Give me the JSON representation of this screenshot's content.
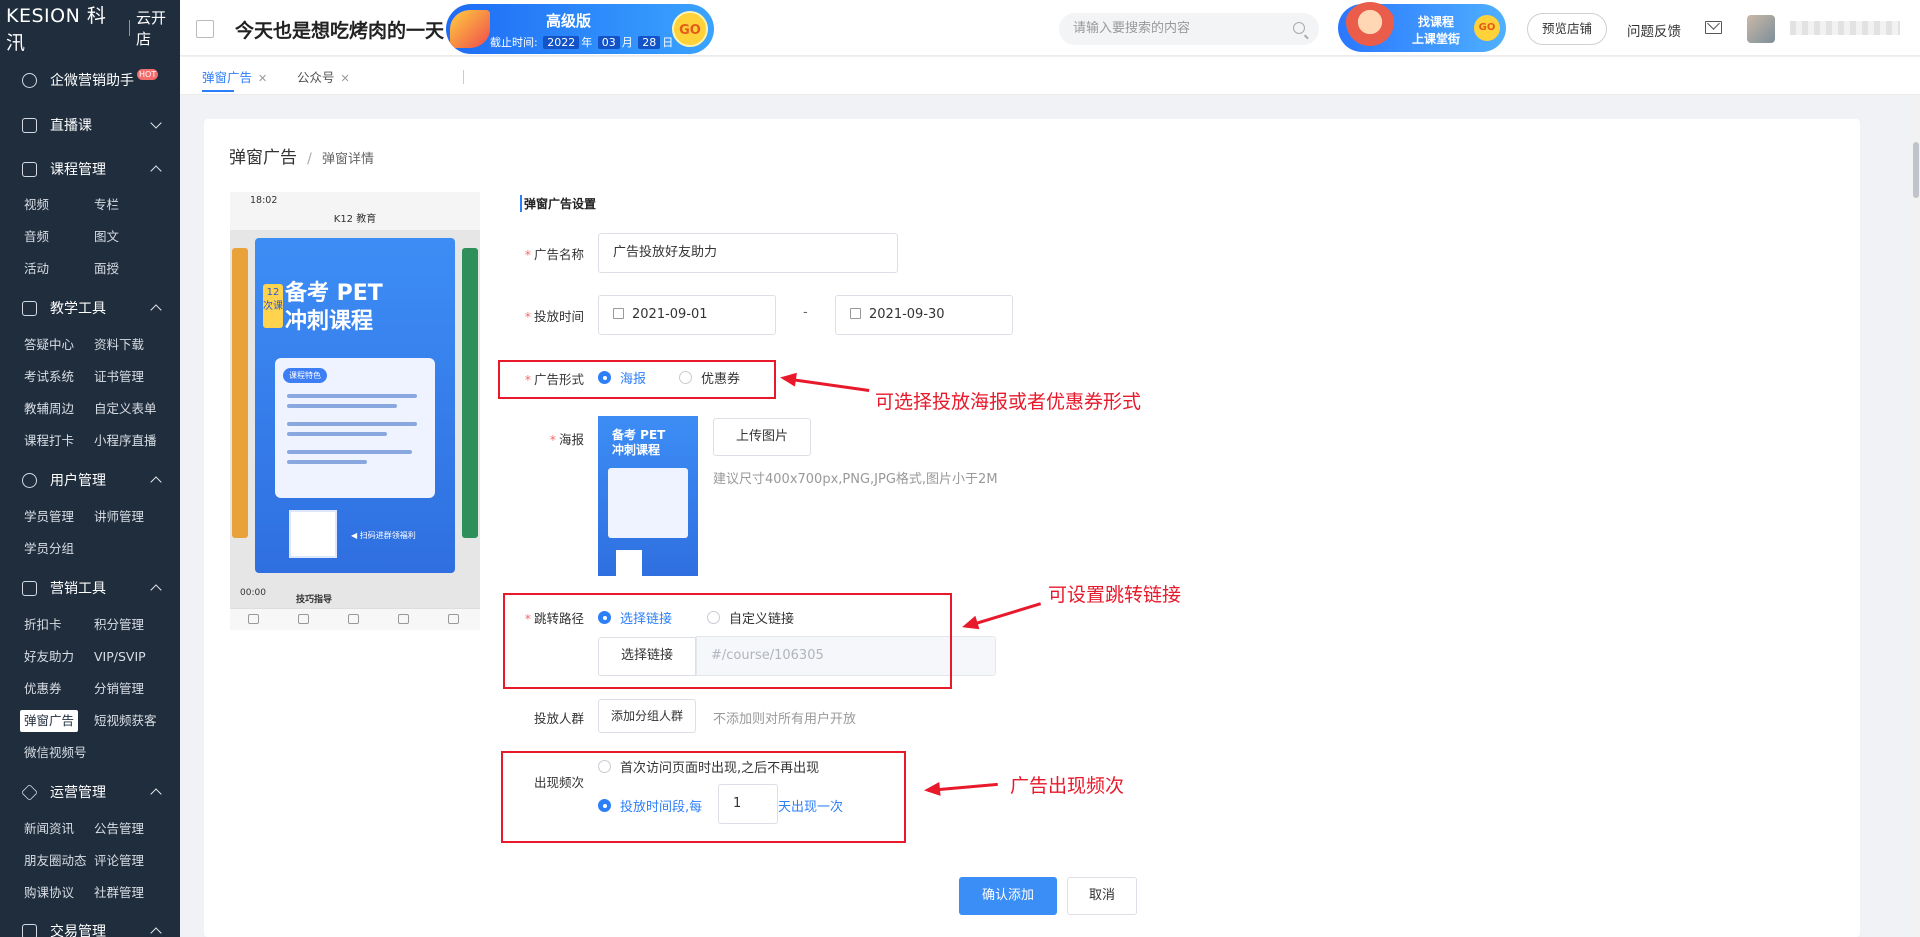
{
  "sidebar": {
    "brand": "KESION 科汛",
    "store": "云开店",
    "groups": {
      "wecom": "企微营销助手",
      "hot": "HOT",
      "live": "直播课",
      "course": "课程管理",
      "teach": "教学工具",
      "user": "用户管理",
      "marketing": "营销工具",
      "ops": "运营管理",
      "trade": "交易管理"
    },
    "course_items": [
      "视频",
      "专栏",
      "音频",
      "图文",
      "活动",
      "面授"
    ],
    "teach_items": [
      "答疑中心",
      "资料下载",
      "考试系统",
      "证书管理",
      "教辅周边",
      "自定义表单",
      "课程打卡",
      "小程序直播"
    ],
    "user_items": [
      "学员管理",
      "讲师管理",
      "学员分组"
    ],
    "marketing_items": [
      "折扣卡",
      "积分管理",
      "好友助力",
      "VIP/SVIP",
      "优惠券",
      "分销管理",
      "弹窗广告",
      "短视频获客",
      "微信视频号"
    ],
    "ops_items": [
      "新闻资讯",
      "公告管理",
      "朋友圈动态",
      "评论管理",
      "购课协议",
      "社群管理"
    ]
  },
  "topbar": {
    "slogan": "今天也是想吃烤肉的一天",
    "promo": {
      "version": "高级版",
      "deadline_label": "截止时间:",
      "year": "2022",
      "year_unit": "年",
      "month": "03",
      "month_unit": "月",
      "day": "28",
      "day_unit": "日",
      "go": "GO"
    },
    "search_placeholder": "请输入要搜索的内容",
    "course_banner": {
      "line1": "找课程",
      "line2": "上课堂街",
      "go": "GO"
    },
    "preview_store": "预览店铺",
    "feedback": "问题反馈"
  },
  "tabs": [
    {
      "label": "弹窗广告",
      "active": true
    },
    {
      "label": "公众号",
      "active": false
    }
  ],
  "breadcrumb": {
    "parent": "弹窗广告",
    "current": "弹窗详情"
  },
  "phone_preview": {
    "time": "18:02",
    "title": "K12 教育",
    "poster_title_line1": "备考 PET",
    "poster_title_line2": "冲刺课程",
    "tag": "12次课",
    "feature": "课程特色",
    "qr_tip": "◀ 扫码进群领福利",
    "clock": "00:00",
    "tips": "技巧指导"
  },
  "form": {
    "section_title": "弹窗广告设置",
    "name_label": "广告名称",
    "name_value": "广告投放好友助力",
    "time_label": "投放时间",
    "start_date": "2021-09-01",
    "date_sep": "-",
    "end_date": "2021-09-30",
    "format_label": "广告形式",
    "format_options": [
      "海报",
      "优惠券"
    ],
    "poster_label": "海报",
    "upload_button": "上传图片",
    "upload_hint": "建议尺寸400x700px,PNG,JPG格式,图片小于2M",
    "jump_label": "跳转路径",
    "jump_options": [
      "选择链接",
      "自定义链接"
    ],
    "select_link_button": "选择链接",
    "link_value": "#/course/106305",
    "audience_label": "投放人群",
    "add_group_button": "添加分组人群",
    "audience_hint": "不添加则对所有用户开放",
    "freq_label": "出现频次",
    "freq_option1": "首次访问页面时出现,之后不再出现",
    "freq_option2_prefix": "投放时间段,每",
    "freq_days": "1",
    "freq_option2_suffix": "天出现一次",
    "confirm_button": "确认添加",
    "cancel_button": "取消"
  },
  "annotations": {
    "format": "可选择投放海报或者优惠券形式",
    "jump": "可设置跳转链接",
    "freq": "广告出现频次"
  },
  "colors": {
    "primary": "#2d7ff9",
    "annotation": "#e8192b",
    "sidebar": "#1f2d3d"
  }
}
